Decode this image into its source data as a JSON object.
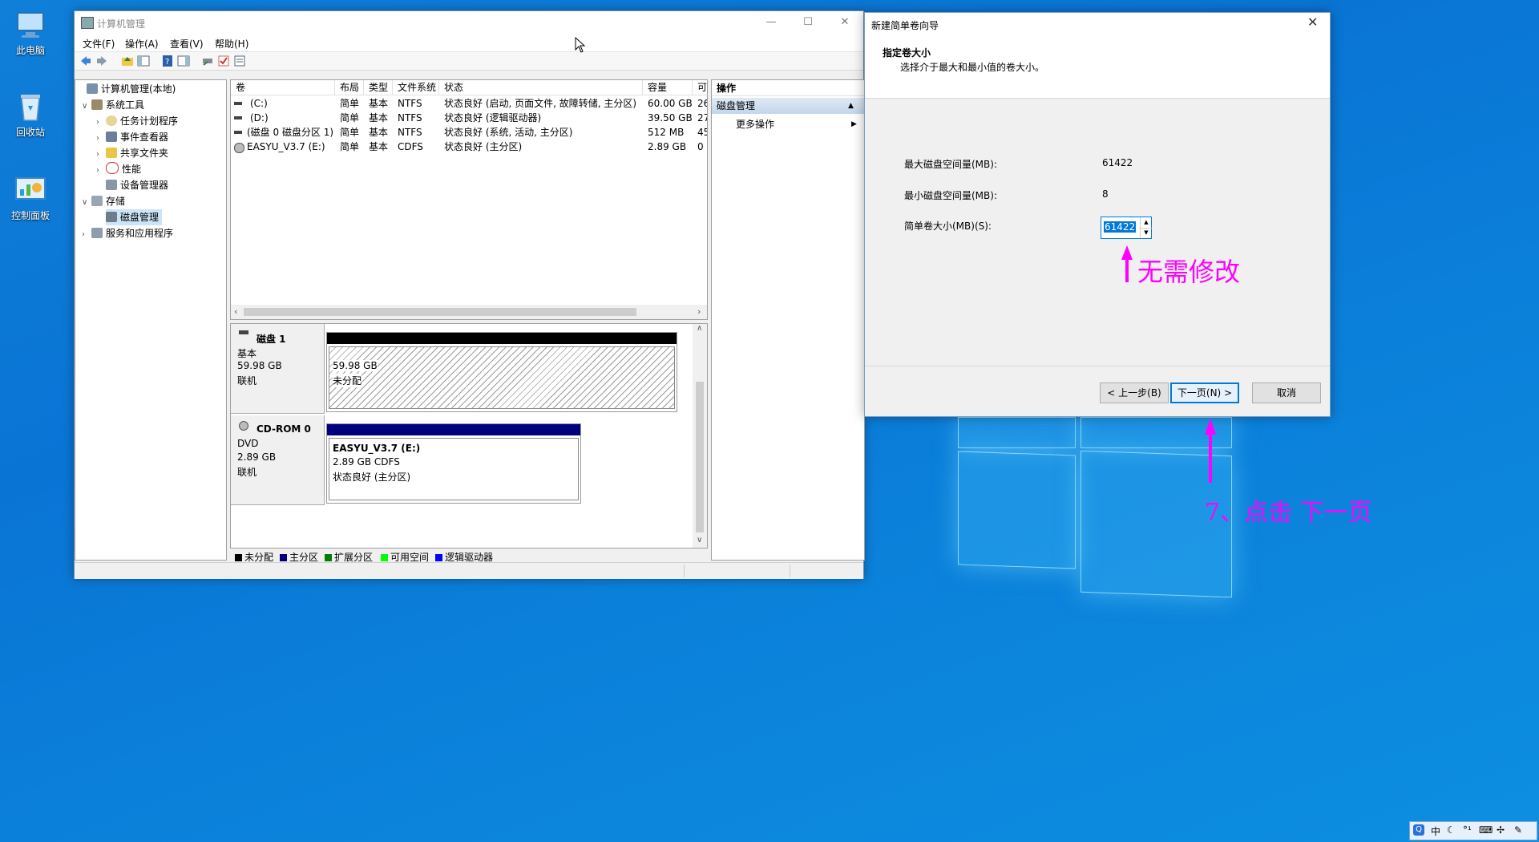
{
  "desktop": {
    "icons": [
      {
        "label": "此电脑",
        "icon": "computer-icon"
      },
      {
        "label": "回收站",
        "icon": "recycle-bin-icon"
      },
      {
        "label": "控制面板",
        "icon": "control-panel-icon"
      }
    ]
  },
  "mmc": {
    "title": "计算机管理",
    "menu": [
      "文件(F)",
      "操作(A)",
      "查看(V)",
      "帮助(H)"
    ],
    "tree": [
      {
        "label": "计算机管理(本地)",
        "icon": "computer-management-icon"
      },
      {
        "label": "系统工具",
        "icon": "tools-icon"
      },
      {
        "label": "任务计划程序",
        "icon": "clock-icon"
      },
      {
        "label": "事件查看器",
        "icon": "event-viewer-icon"
      },
      {
        "label": "共享文件夹",
        "icon": "shared-folder-icon"
      },
      {
        "label": "性能",
        "icon": "performance-icon"
      },
      {
        "label": "设备管理器",
        "icon": "device-manager-icon"
      },
      {
        "label": "存储",
        "icon": "storage-icon"
      },
      {
        "label": "磁盘管理",
        "icon": "disk-management-icon"
      },
      {
        "label": "服务和应用程序",
        "icon": "services-icon"
      }
    ],
    "columns": [
      "卷",
      "布局",
      "类型",
      "文件系统",
      "状态",
      "容量",
      "可"
    ],
    "volumes": [
      [
        "(C:)",
        "简单",
        "基本",
        "NTFS",
        "状态良好 (启动, 页面文件, 故障转储, 主分区)",
        "60.00 GB",
        "26"
      ],
      [
        "(D:)",
        "简单",
        "基本",
        "NTFS",
        "状态良好 (逻辑驱动器)",
        "39.50 GB",
        "27"
      ],
      [
        "(磁盘 0 磁盘分区 1)",
        "简单",
        "基本",
        "NTFS",
        "状态良好 (系统, 活动, 主分区)",
        "512 MB",
        "45"
      ],
      [
        "EASYU_V3.7 (E:)",
        "简单",
        "基本",
        "CDFS",
        "状态良好 (主分区)",
        "2.89 GB",
        "0 I"
      ]
    ],
    "disk1": {
      "name": "磁盘 1",
      "type": "基本",
      "size": "59.98 GB",
      "status": "联机",
      "part_size": "59.98 GB",
      "part_status": "未分配"
    },
    "cdrom": {
      "name": "CD-ROM 0",
      "type": "DVD",
      "size": "2.89 GB",
      "status": "联机",
      "part_name": "EASYU_V3.7  (E:)",
      "part_size": "2.89 GB CDFS",
      "part_status": "状态良好 (主分区)"
    },
    "legend": [
      {
        "label": "未分配",
        "color": "#000000"
      },
      {
        "label": "主分区",
        "color": "#00007f"
      },
      {
        "label": "扩展分区",
        "color": "#007f00"
      },
      {
        "label": "可用空间",
        "color": "#00ff00"
      },
      {
        "label": "逻辑驱动器",
        "color": "#0000ff"
      }
    ],
    "actions": {
      "header": "操作",
      "section": "磁盘管理",
      "more": "更多操作"
    }
  },
  "wizard": {
    "title": "新建简单卷向导",
    "heading": "指定卷大小",
    "subheading": "选择介于最大和最小值的卷大小。",
    "max_label": "最大磁盘空间量(MB):",
    "max_value": "61422",
    "min_label": "最小磁盘空间量(MB):",
    "min_value": "8",
    "size_label": "简单卷大小(MB)(S):",
    "size_value": "61422",
    "back": "< 上一步(B)",
    "next": "下一页(N) >",
    "cancel": "取消"
  },
  "annotations": {
    "no_change": "无需修改",
    "click_next": "7、点击  下一页",
    "color": "#ff00ff"
  },
  "tray": {
    "items": [
      "中",
      "♪",
      "°¹",
      "⌨",
      "⚙",
      "🔧"
    ]
  }
}
